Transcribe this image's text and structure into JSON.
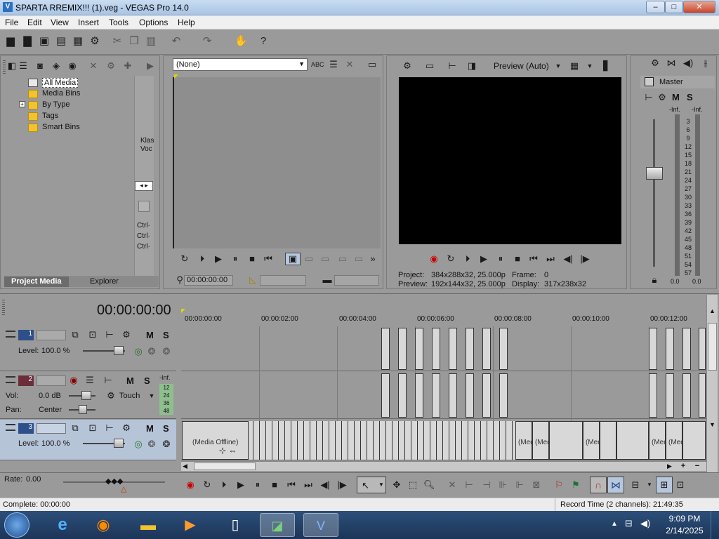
{
  "window": {
    "title": "SPARTA RREMIX!!! (1).veg - VEGAS Pro 14.0",
    "controls": {
      "minimize": "–",
      "maximize": "□",
      "close": "✕"
    }
  },
  "menu": [
    "File",
    "Edit",
    "View",
    "Insert",
    "Tools",
    "Options",
    "Help"
  ],
  "project_media": {
    "tree": [
      "All Media",
      "Media Bins",
      "By Type",
      "Tags",
      "Smart Bins"
    ],
    "side_text": [
      "Klas",
      "Voc"
    ],
    "shortcut_text": [
      "Ctrl·",
      "Ctrl·",
      "Ctrl·"
    ],
    "tabs": [
      "Project Media",
      "Explorer"
    ]
  },
  "trimmer": {
    "select_value": "(None)",
    "timecode": "00:00:00:00"
  },
  "preview": {
    "quality": "Preview (Auto)",
    "project_label": "Project:",
    "project_value": "384x288x32, 25.000p",
    "frame_label": "Frame:",
    "frame_value": "0",
    "preview_label": "Preview:",
    "preview_value": "192x144x32, 25.000p",
    "display_label": "Display:",
    "display_value": "317x238x32"
  },
  "mixer": {
    "title": "Master",
    "m": "M",
    "s": "S",
    "inf_left": "-Inf.",
    "inf_right": "-Inf.",
    "ticks": [
      "3",
      "6",
      "9",
      "12",
      "15",
      "18",
      "21",
      "24",
      "27",
      "30",
      "33",
      "36",
      "39",
      "42",
      "45",
      "48",
      "51",
      "54",
      "57"
    ],
    "val_left": "0.0",
    "val_right": "0.0"
  },
  "timeline": {
    "timecode": "00:00:00:00",
    "ruler": [
      "00:00:00:00",
      "00:00:02:00",
      "00:00:04:00",
      "00:00:06:00",
      "00:00:08:00",
      "00:00:10:00",
      "00:00:12:00"
    ],
    "tracks": [
      {
        "num": "1",
        "level_label": "Level:",
        "level": "100.0 %",
        "m": "M",
        "s": "S"
      },
      {
        "num": "2",
        "vol_label": "Vol:",
        "vol": "0.0 dB",
        "pan_label": "Pan:",
        "pan": "Center",
        "mode": "Touch",
        "m": "M",
        "s": "S",
        "inf": "-Inf.",
        "meter": [
          "12",
          "24",
          "36",
          "48"
        ]
      },
      {
        "num": "3",
        "level_label": "Level:",
        "level": "100.0 %",
        "m": "M",
        "s": "S"
      }
    ],
    "media_offline": "(Media Offline)",
    "med_short": "(Med"
  },
  "rate": {
    "label": "Rate:",
    "value": "0.00"
  },
  "status": {
    "complete": "Complete: 00:00:00",
    "record_time": "Record Time (2 channels): 21:49:35"
  },
  "taskbar": {
    "time": "9:09 PM",
    "date": "2/14/2025"
  }
}
